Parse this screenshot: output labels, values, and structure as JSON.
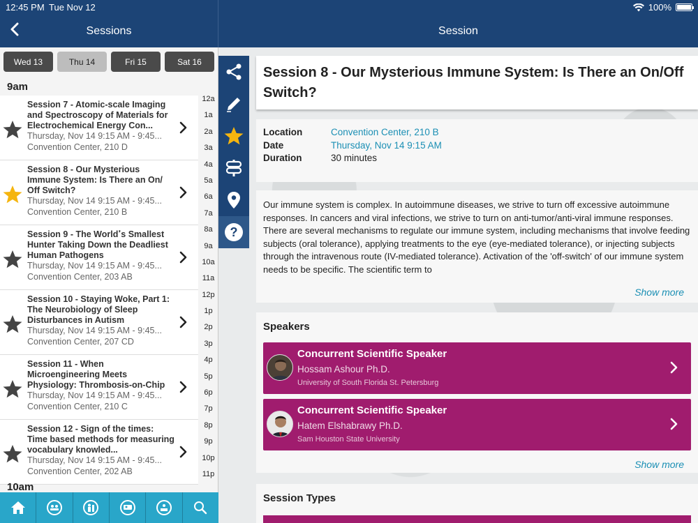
{
  "status": {
    "time": "12:45 PM",
    "date": "Tue Nov 12",
    "battery": "100%",
    "battery_level": 1.0
  },
  "nav": {
    "back_icon": "chevron-left-icon",
    "left_title": "Sessions",
    "right_title": "Session"
  },
  "days": [
    {
      "label": "Wed 13",
      "active": false
    },
    {
      "label": "Thu 14",
      "active": true
    },
    {
      "label": "Fri 15",
      "active": false
    },
    {
      "label": "Sat 16",
      "active": false
    }
  ],
  "hour_header": "9am",
  "hour_header_next": "10am",
  "hour_index": [
    "12a",
    "1a",
    "2a",
    "3a",
    "4a",
    "5a",
    "6a",
    "7a",
    "8a",
    "9a",
    "10a",
    "11a",
    "12p",
    "1p",
    "2p",
    "3p",
    "4p",
    "5p",
    "6p",
    "7p",
    "8p",
    "9p",
    "10p",
    "11p"
  ],
  "sessions": [
    {
      "title": "Session 7 - Atomic-scale Imaging and Spectroscopy of Materials for Electrochemical Energy Con...",
      "time": "Thursday, Nov 14 9:15 AM - 9:45...",
      "location": "Convention Center, 210 D",
      "favorite": false
    },
    {
      "title": "Session 8 - Our Mysterious Immune System: Is There an On/ Off Switch?",
      "time": "Thursday, Nov 14 9:15 AM - 9:45...",
      "location": "Convention Center, 210 B",
      "favorite": true
    },
    {
      "title": "Session 9 - The Worldߴs Smallest Hunter Taking Down the Deadliest Human Pathogens",
      "time": "Thursday, Nov 14 9:15 AM - 9:45...",
      "location": "Convention Center, 203 AB",
      "favorite": false
    },
    {
      "title": "Session 10 - Staying Woke, Part 1: The Neurobiology of Sleep Disturbances in Autism",
      "time": "Thursday, Nov 14 9:15 AM - 9:45...",
      "location": "Convention Center, 207 CD",
      "favorite": false
    },
    {
      "title": "Session 11 - When Microengineering Meets Physiology: Thrombosis-on-Chip",
      "time": "Thursday, Nov 14 9:15 AM - 9:45...",
      "location": "Convention Center, 210 C",
      "favorite": false
    },
    {
      "title": "Session 12 - Sign of the times: Time based methods for measuring vocabulary knowled...",
      "time": "Thursday, Nov 14 9:15 AM - 9:45...",
      "location": "Convention Center, 202 AB",
      "favorite": false
    }
  ],
  "tabs": [
    {
      "icon": "home-icon"
    },
    {
      "icon": "attendees-icon"
    },
    {
      "icon": "exhibitor-icon"
    },
    {
      "icon": "speaker-icon"
    },
    {
      "icon": "sponsor-icon"
    },
    {
      "icon": "search-icon"
    }
  ],
  "rail": [
    {
      "icon": "share-icon"
    },
    {
      "icon": "pencil-icon"
    },
    {
      "icon": "star-icon"
    },
    {
      "icon": "signpost-icon"
    },
    {
      "icon": "location-pin-icon"
    },
    {
      "icon": "help-icon"
    }
  ],
  "detail": {
    "title": "Session 8 - Our Mysterious Immune System: Is There an On/Off Switch?",
    "location_label": "Location",
    "location_value": "Convention Center, 210 B",
    "date_label": "Date",
    "date_value": "Thursday, Nov 14 9:15 AM",
    "duration_label": "Duration",
    "duration_value": "30 minutes",
    "description": "Our immune system is complex. In autoimmune diseases, we strive to turn off excessive autoimmune responses. In cancers and viral infections, we strive to turn on anti-tumor/anti-viral immune responses. There are several mechanisms to regulate our immune system, including mechanisms that involve feeding subjects (oral tolerance), applying treatments to the eye (eye-mediated tolerance), or injecting subjects through the intravenous route (IV-mediated tolerance). Activation of the 'off-switch' of our immune system needs to be specific. The scientific term to",
    "show_more": "Show more"
  },
  "speakers": {
    "heading": "Speakers",
    "items": [
      {
        "role": "Concurrent Scientific Speaker",
        "name": "Hossam Ashour Ph.D.",
        "institution": "University of South Florida St. Petersburg"
      },
      {
        "role": "Concurrent Scientific Speaker",
        "name": "Hatem Elshabrawy Ph.D.",
        "institution": "Sam Houston State University"
      }
    ],
    "show_more": "Show more"
  },
  "session_types": {
    "heading": "Session Types"
  },
  "colors": {
    "nav_bg": "#1c4476",
    "tab_bg": "#29a6c9",
    "speaker_bg": "#a01c6e",
    "link": "#1b8fb4",
    "star_active": "#f5b50f",
    "star_inactive": "#444444"
  }
}
